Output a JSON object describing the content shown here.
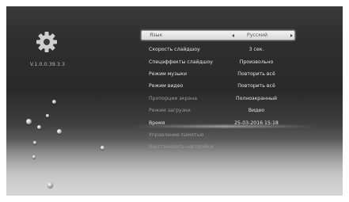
{
  "sidebar": {
    "icon": "gear-icon",
    "version_label": "V.1.0.0.39.3.3"
  },
  "menu": {
    "items": [
      {
        "label": "Язык",
        "value": "Русский",
        "selected": true
      },
      {
        "label": "Скорость слайдшоу",
        "value": "3 сек."
      },
      {
        "label": "Спецэффекты слайдшоу",
        "value": "Произвольно"
      },
      {
        "label": "Режим музыки",
        "value": "Повторить всё"
      },
      {
        "label": "Режим видео",
        "value": "Повторить всё"
      },
      {
        "label": "Пропорции экрана",
        "value": "Полноэкранный"
      },
      {
        "label": "Режим загрузки",
        "value": "Видео"
      },
      {
        "label": "Время",
        "value": "25-03-2016    15:18"
      },
      {
        "label": "Управление памятью",
        "value": ""
      },
      {
        "label": "Восстановить настройки",
        "value": ""
      }
    ]
  },
  "colors": {
    "selected_bg": "#e6e6e6",
    "text": "#e6e6e6",
    "dim_text": "#9a9a9a"
  }
}
